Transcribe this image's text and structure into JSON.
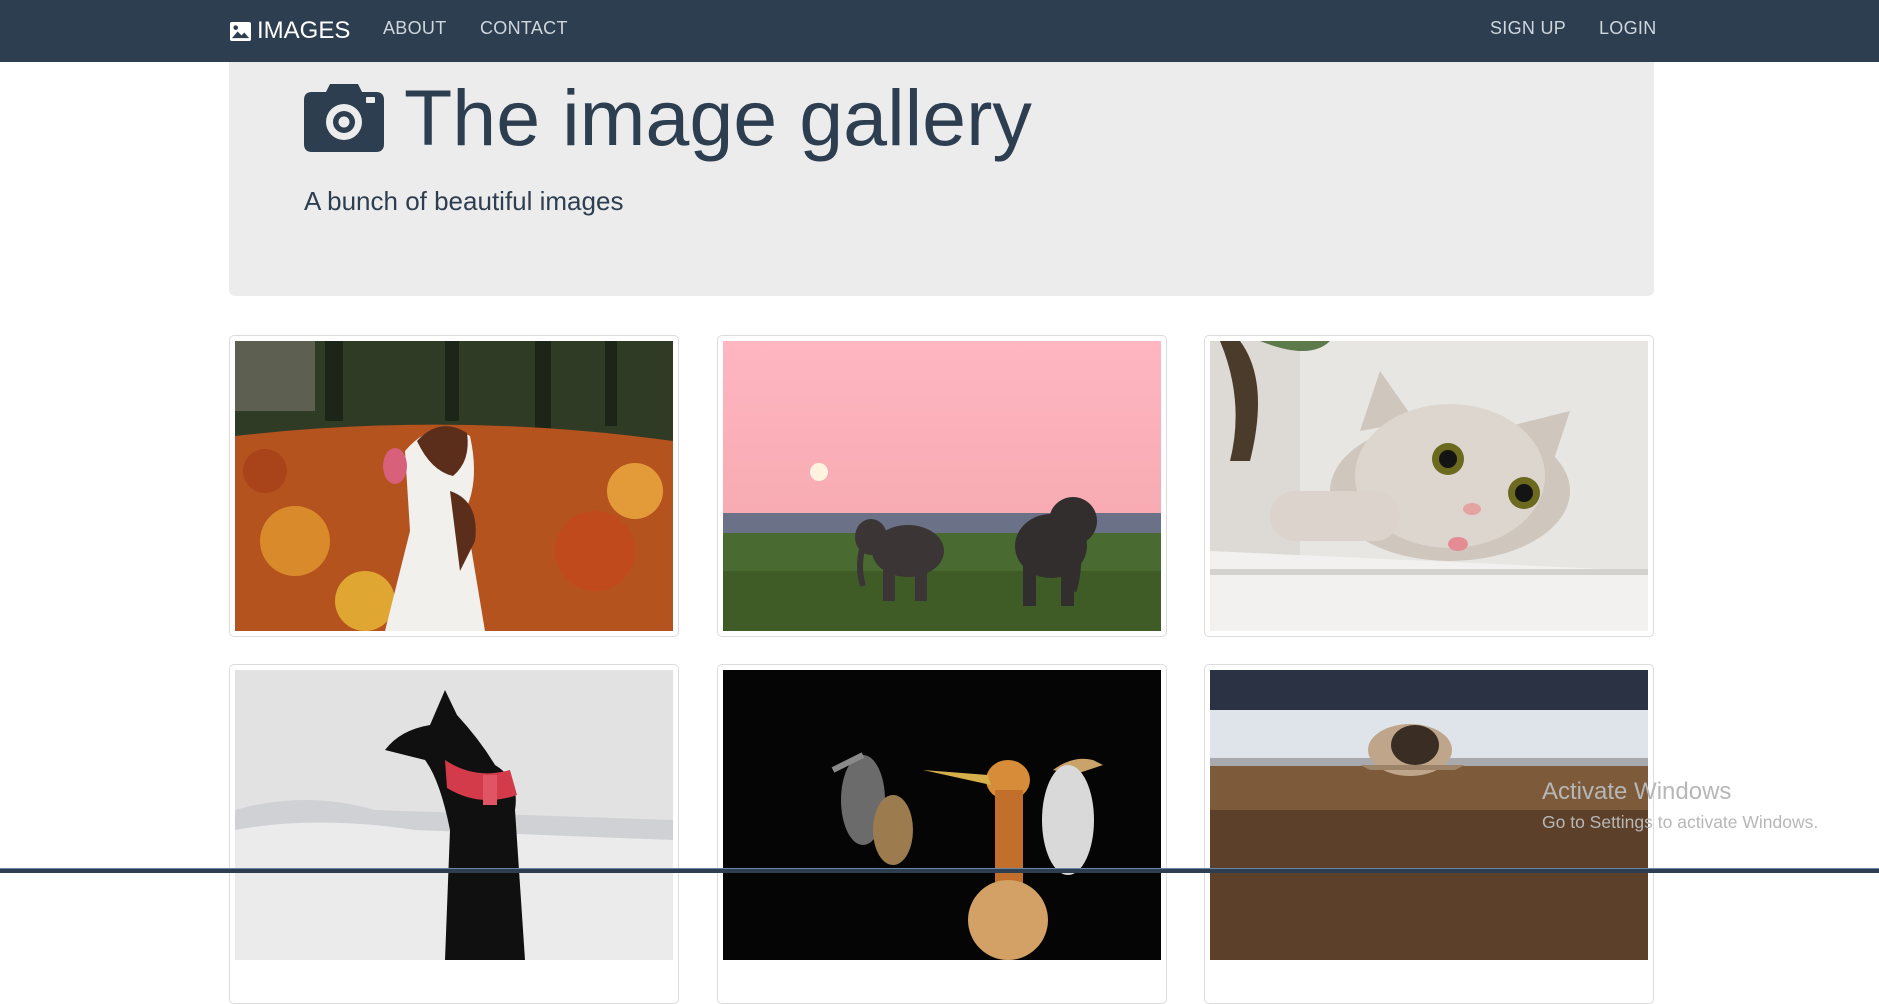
{
  "navbar": {
    "brand_label": "IMAGES",
    "brand_icon": "image-icon",
    "left_links": [
      "ABOUT",
      "CONTACT"
    ],
    "right_links": [
      "SIGN UP",
      "LOGIN"
    ],
    "background": "#2d3e50"
  },
  "hero": {
    "icon": "camera-icon",
    "title": "The image gallery",
    "subtitle": "A bunch of beautiful images",
    "background": "#ececec",
    "text_color": "#2d3e50"
  },
  "gallery": {
    "items": [
      {
        "subject": "dog in autumn leaves"
      },
      {
        "subject": "elephants at sunset"
      },
      {
        "subject": "surprised cat"
      },
      {
        "subject": "black dog in snow"
      },
      {
        "subject": "egrets on black background"
      },
      {
        "subject": "pug lying on floor"
      }
    ]
  },
  "watermark": {
    "title": "Activate Windows",
    "subtitle": "Go to Settings to activate Windows."
  }
}
